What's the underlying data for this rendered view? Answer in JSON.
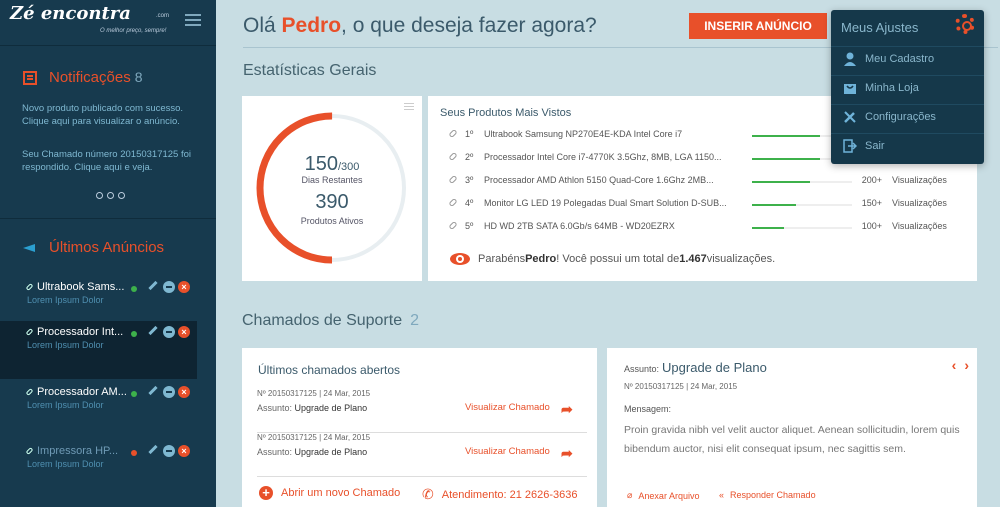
{
  "brand": {
    "logo": "Zé encontra",
    "tagline": "O melhor preço, sempre!",
    "suffix": ".com"
  },
  "sidebar": {
    "notifications": {
      "title": "Notificações",
      "count": "8",
      "messages": [
        "Novo produto publicado com sucesso. Clique aqui para visualizar o anúncio.",
        "Seu Chamado número 20150317125 foi respondido. Clique aqui e veja."
      ]
    },
    "ads": {
      "title": "Últimos Anúncios",
      "items": [
        {
          "name": "Ultrabook Sams...",
          "sub": "Lorem Ipsum Dolor",
          "status_color": "#3db14b"
        },
        {
          "name": "Processador Int...",
          "sub": "Lorem Ipsum Dolor",
          "status_color": "#3db14b"
        },
        {
          "name": "Processador AM...",
          "sub": "Lorem Ipsum Dolor",
          "status_color": "#3db14b"
        },
        {
          "name": "Impressora HP...",
          "sub": "Lorem Ipsum Dolor",
          "status_color": "#e8502a"
        }
      ]
    }
  },
  "header": {
    "greeting_pre": "Olá ",
    "user": "Pedro",
    "greeting_post": ", o que deseja fazer agora?",
    "insert_button": "INSERIR ANÚNCIO"
  },
  "stats": {
    "section_title": "Estatísticas Gerais",
    "days": "150",
    "days_total": "/300",
    "days_label": "Dias Restantes",
    "products": "390",
    "products_label": "Produtos Ativos",
    "gauge_fraction": 0.5
  },
  "most_viewed": {
    "title": "Seus Produtos Mais Vistos",
    "items": [
      {
        "rank": "1º",
        "name": "Ultrabook Samsung NP270E4E-KDA Intel Core i7",
        "count": "",
        "label": "",
        "fraction": 0.68
      },
      {
        "rank": "2º",
        "name": "Processador Intel Core i7-4770K 3.5Ghz, 8MB, LGA 1150...",
        "count": "",
        "label": "",
        "fraction": 0.68
      },
      {
        "rank": "3º",
        "name": "Processador AMD Athlon 5150 Quad-Core 1.6Ghz 2MB...",
        "count": "200+",
        "label": "Visualizações",
        "fraction": 0.58
      },
      {
        "rank": "4º",
        "name": "Monitor LG LED 19 Polegadas Dual Smart Solution D-SUB...",
        "count": "150+",
        "label": "Visualizações",
        "fraction": 0.44
      },
      {
        "rank": "5º",
        "name": "HD WD 2TB SATA 6.0Gb/s 64MB - WD20EZRX",
        "count": "100+",
        "label": "Visualizações",
        "fraction": 0.32
      }
    ],
    "congrats_pre": "Parabéns ",
    "congrats_user": "Pedro",
    "congrats_mid": "! Você possui um total de ",
    "congrats_total": "1.467",
    "congrats_post": " visualizações."
  },
  "support": {
    "section_title": "Chamados de Suporte",
    "count": "2",
    "list_title": "Últimos chamados abertos",
    "tickets": [
      {
        "meta": "Nº 20150317125  |  24 Mar, 2015",
        "subject_label": "Assunto: ",
        "subject": "Upgrade de Plano",
        "action": "Visualizar Chamado"
      },
      {
        "meta": "Nº 20150317125  |  24 Mar, 2015",
        "subject_label": "Assunto: ",
        "subject": "Upgrade de Plano",
        "action": "Visualizar Chamado"
      }
    ],
    "new_ticket": "Abrir um novo Chamado",
    "phone": "Atendimento: 21 2626-3636"
  },
  "ticket_detail": {
    "subject_label": "Assunto:",
    "subject": "Upgrade de Plano",
    "meta": "Nº 20150317125  |  24 Mar, 2015",
    "message_label": "Mensagem:",
    "message": "Proin gravida nibh vel velit auctor aliquet. Aenean sollicitudin, lorem quis bibendum auctor, nisi elit consequat ipsum, nec sagittis sem.",
    "attach": "Anexar Arquivo",
    "reply": "Responder Chamado"
  },
  "dropdown": {
    "title": "Meus Ajustes",
    "items": [
      {
        "label": "Meu Cadastro",
        "icon": "user-icon"
      },
      {
        "label": "Minha Loja",
        "icon": "store-icon"
      },
      {
        "label": "Configurações",
        "icon": "tools-icon"
      },
      {
        "label": "Sair",
        "icon": "logout-icon"
      }
    ]
  },
  "colors": {
    "accent": "#e8502a",
    "sidebar": "#173a4e",
    "green": "#3db14b",
    "background": "#c8dde3"
  }
}
